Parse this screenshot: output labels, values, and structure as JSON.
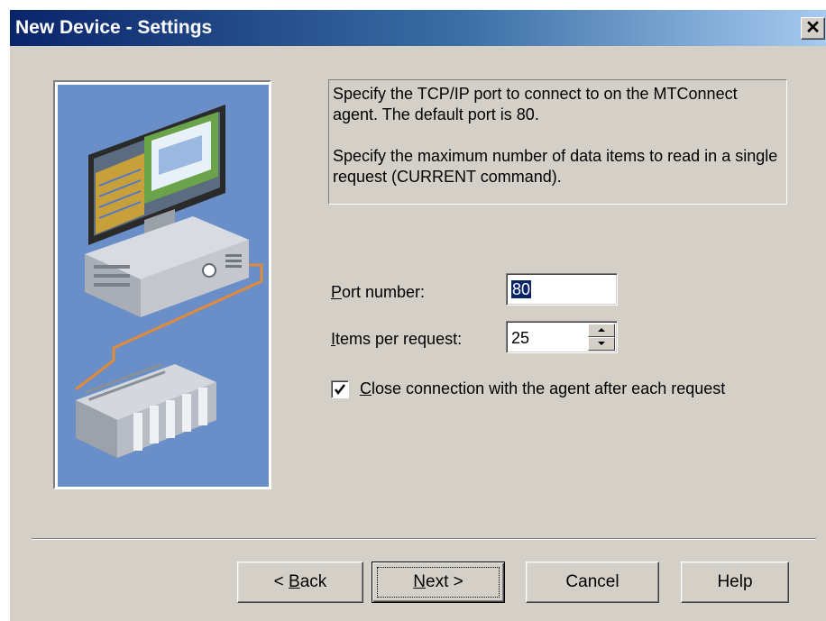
{
  "window": {
    "title": "New Device - Settings",
    "close_glyph": "✕"
  },
  "description": {
    "paragraph1": "Specify the TCP/IP port to connect to on the MTConnect agent. The default port is 80.",
    "paragraph2": "Specify the maximum number of data items to read in a single request (CURRENT command)."
  },
  "form": {
    "port_label_mnemonic": "P",
    "port_label_rest": "ort number:",
    "port_value": "80",
    "items_label_mnemonic": "I",
    "items_label_rest": "tems per request:",
    "items_value": "25",
    "close_conn_checked": true,
    "close_conn_mnemonic": "C",
    "close_conn_rest": "lose connection with the agent after each request"
  },
  "buttons": {
    "back_prefix": "< ",
    "back_mnemonic": "B",
    "back_rest": "ack",
    "next_mnemonic": "N",
    "next_rest": "ext >",
    "cancel": "Cancel",
    "help": "Help"
  },
  "icons": {
    "close": "close-icon",
    "spin_up": "arrow-up-icon",
    "spin_down": "arrow-down-icon",
    "check": "checkmark-icon",
    "illustration": "computer-and-plc-illustration"
  },
  "colors": {
    "titlebar_start": "#0a246a",
    "titlebar_end": "#a6caf0",
    "dialog_face": "#d4d0c8",
    "illustration_bg": "#6a8fc8",
    "selection": "#0a246a"
  }
}
